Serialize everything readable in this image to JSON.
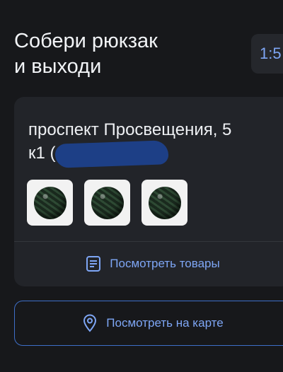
{
  "header": {
    "title_line1": "Собери рюкзак",
    "title_line2": "и выходи",
    "timer": "1:5"
  },
  "order_card": {
    "address_line1": "проспект Просвещения, 5",
    "address_line2": "к1 (",
    "items": [
      {
        "icon": "watermelon-icon"
      },
      {
        "icon": "watermelon-icon"
      },
      {
        "icon": "watermelon-icon"
      }
    ],
    "view_items_label": "Посмотреть товары"
  },
  "map_button": {
    "label": "Посмотреть на карте"
  },
  "colors": {
    "background": "#17181b",
    "card": "#222429",
    "accent": "#7ea6f5",
    "border": "#3e6fc8"
  }
}
